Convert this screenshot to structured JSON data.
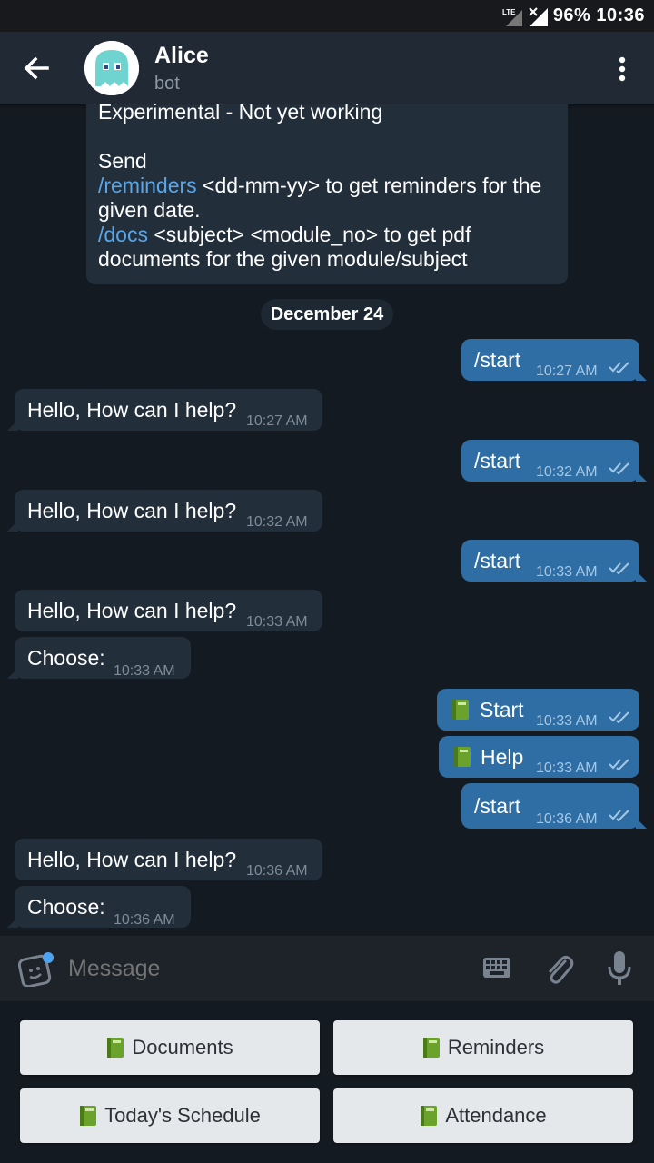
{
  "status_bar": {
    "network": "LTE",
    "battery": "96%",
    "time": "10:36"
  },
  "header": {
    "title": "Alice",
    "subtitle": "bot"
  },
  "top_message": {
    "line1": "Experimental - Not yet working",
    "line2": "Send",
    "cmd1": "/reminders",
    "cmd1_rest": " <dd-mm-yy> to get reminders for the",
    "cmd1_rest2": "given date.",
    "cmd2": "/docs",
    "cmd2_rest": " <subject> <module_no> to get pdf",
    "cmd2_rest2": "documents for the given module/subject"
  },
  "date_separator": "December 24",
  "messages": [
    {
      "dir": "out",
      "text": "/start",
      "time": "10:27 AM"
    },
    {
      "dir": "in",
      "text": "Hello, How can I help?",
      "time": "10:27 AM"
    },
    {
      "dir": "out",
      "text": "/start",
      "time": "10:32 AM"
    },
    {
      "dir": "in",
      "text": "Hello, How can I help?",
      "time": "10:32 AM"
    },
    {
      "dir": "out",
      "text": "/start",
      "time": "10:33 AM"
    },
    {
      "dir": "in",
      "text": "Hello, How can I help?",
      "time": "10:33 AM"
    },
    {
      "dir": "in",
      "text": "Choose:",
      "time": "10:33 AM"
    },
    {
      "dir": "out",
      "text": "Start",
      "time": "10:33 AM",
      "icon": "green-book-icon"
    },
    {
      "dir": "out",
      "text": "Help",
      "time": "10:33 AM",
      "icon": "green-book-icon"
    },
    {
      "dir": "out",
      "text": "/start",
      "time": "10:36 AM"
    },
    {
      "dir": "in",
      "text": "Hello, How can I help?",
      "time": "10:36 AM"
    },
    {
      "dir": "in",
      "text": "Choose:",
      "time": "10:36 AM"
    }
  ],
  "composer": {
    "placeholder": "Message"
  },
  "bot_keyboard": {
    "buttons": [
      "Documents",
      "Reminders",
      "Today's Schedule",
      "Attendance"
    ],
    "icon": "green-book-icon"
  },
  "colors": {
    "background": "#141a21",
    "incoming_bubble": "#222e3a",
    "outgoing_bubble": "#2e6ea4",
    "link": "#5aa6e8",
    "header": "#212a34"
  }
}
